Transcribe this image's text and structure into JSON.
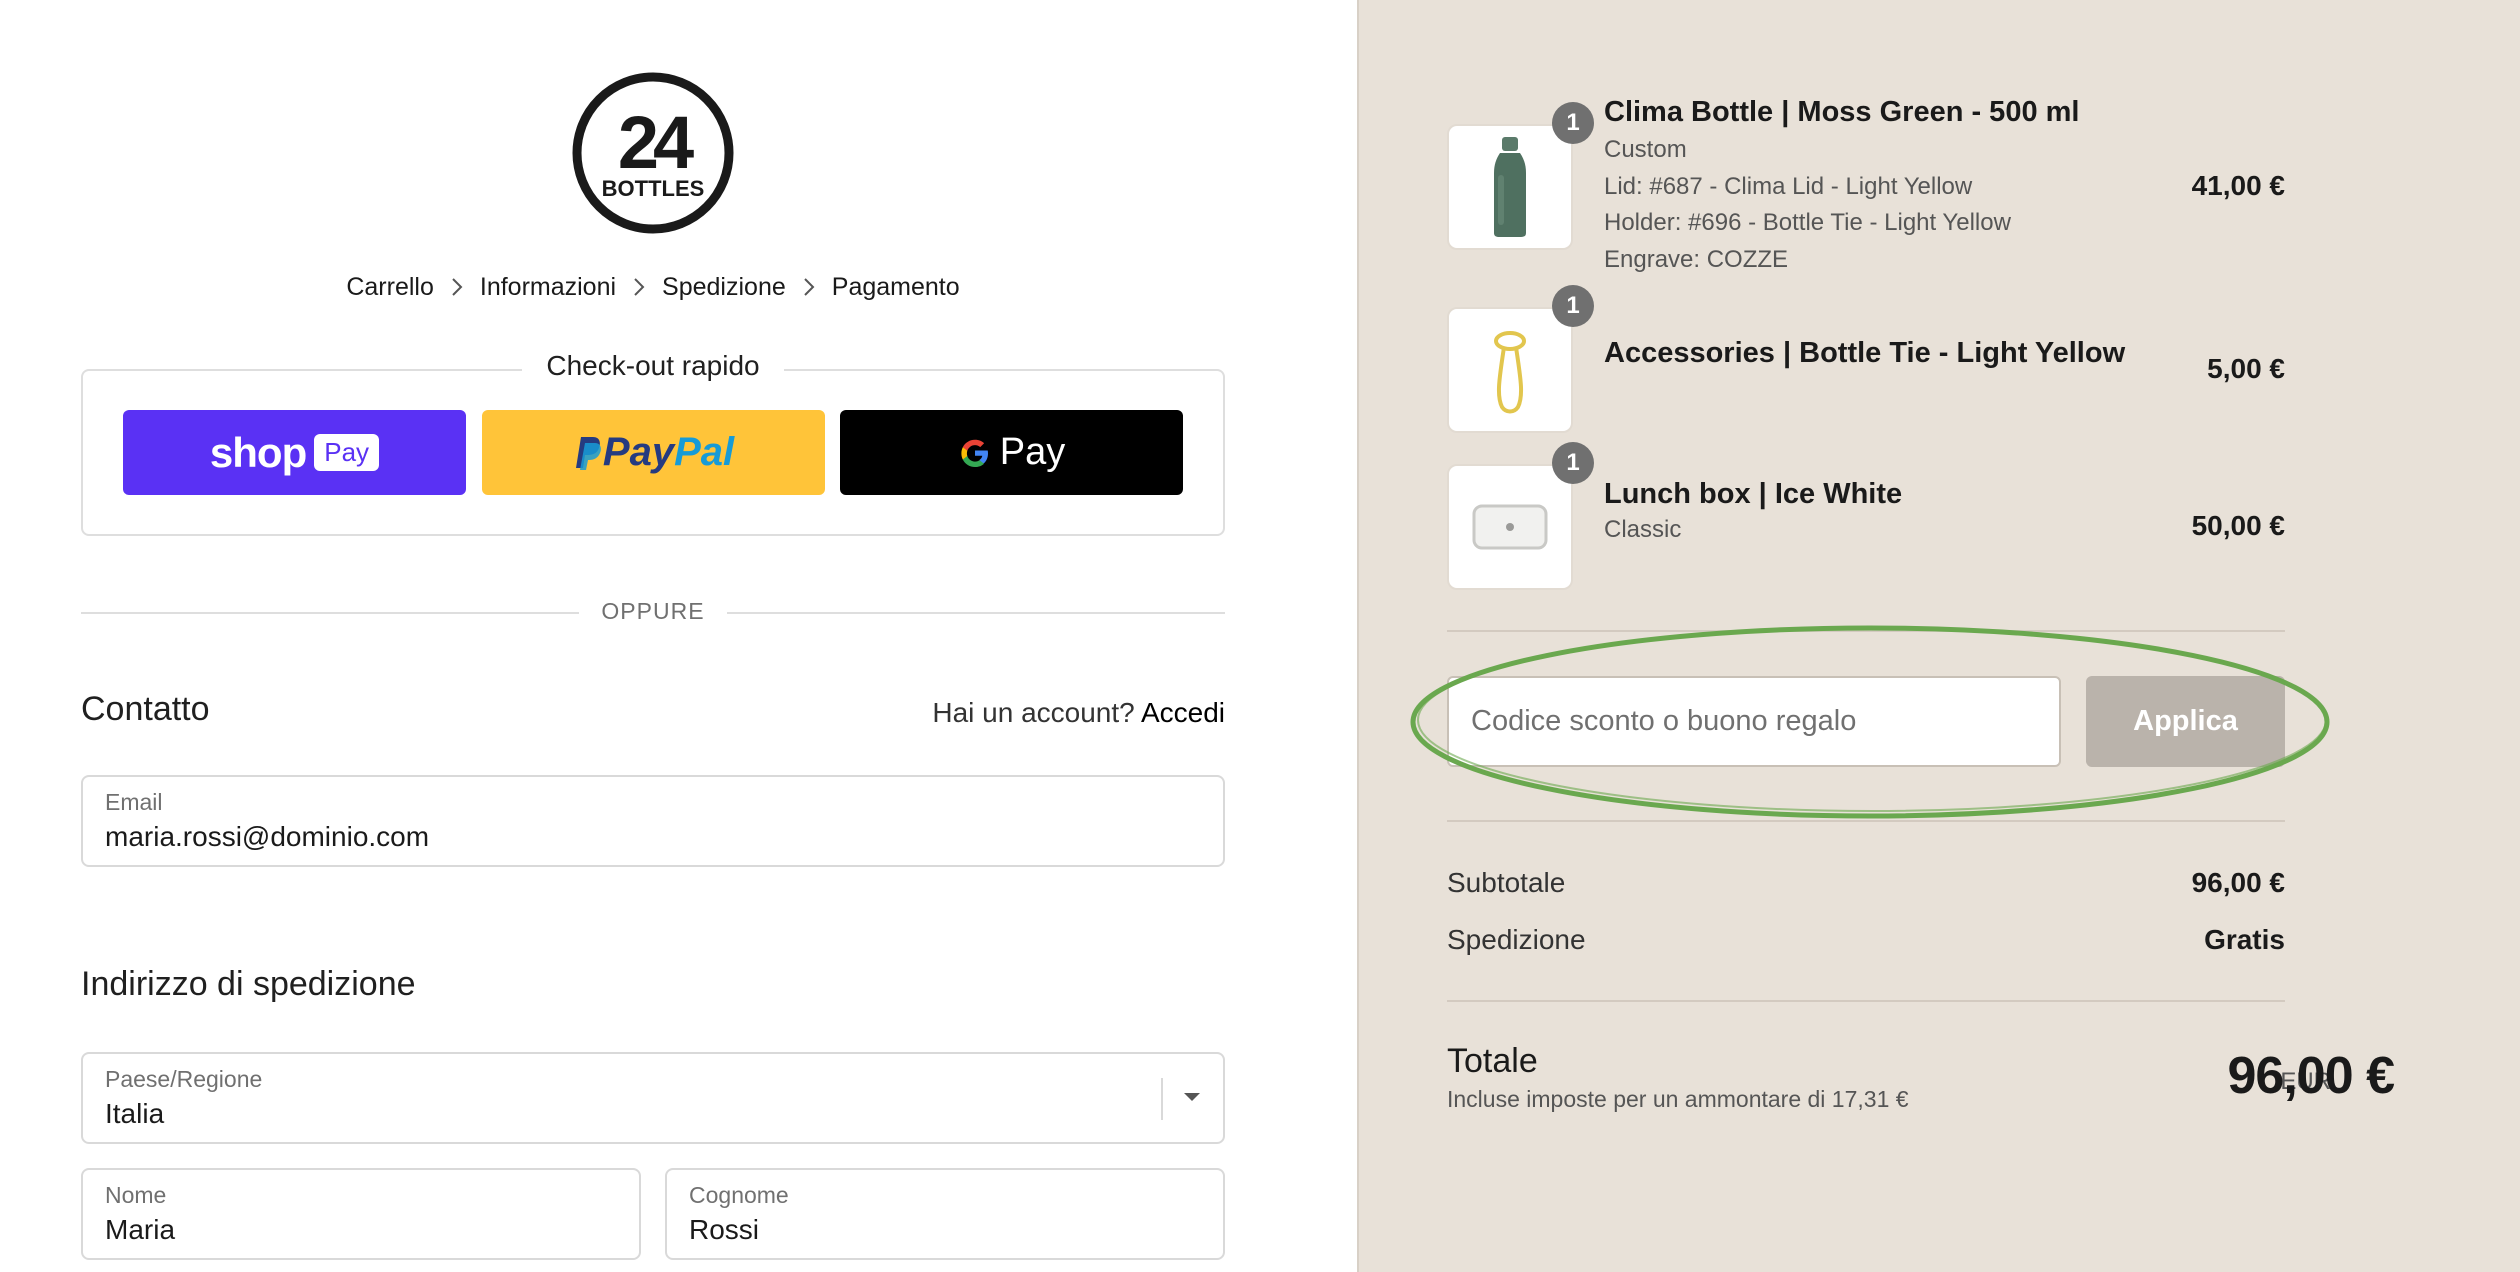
{
  "brand": {
    "logo_number": "24",
    "logo_word": "BOTTLES"
  },
  "breadcrumb": [
    "Carrello",
    "Informazioni",
    "Spedizione",
    "Pagamento"
  ],
  "express_checkout": {
    "title": "Check-out rapido",
    "shop_pay": {
      "word": "shop",
      "pill": "Pay"
    },
    "paypal": {
      "pay": "Pay",
      "pal": "Pal"
    },
    "gpay": {
      "word": "Pay"
    }
  },
  "divider_text": "OPPURE",
  "contact": {
    "title": "Contatto",
    "account_prompt": "Hai un account?",
    "login_link": "Accedi",
    "email_label": "Email",
    "email_value": "maria.rossi@dominio.com"
  },
  "shipping": {
    "title": "Indirizzo di spedizione",
    "country_label": "Paese/Regione",
    "country_value": "Italia",
    "first_name_label": "Nome",
    "first_name_value": "Maria",
    "last_name_label": "Cognome",
    "last_name_value": "Rossi"
  },
  "cart": {
    "items": [
      {
        "qty": "1",
        "name": "Clima Bottle | Moss Green - 500 ml",
        "details": [
          "Custom",
          "Lid: #687 - Clima Lid - Light Yellow",
          "Holder: #696 - Bottle Tie - Light Yellow",
          "Engrave: COZZE"
        ],
        "price": "41,00 €",
        "icon": "bottle-icon"
      },
      {
        "qty": "1",
        "name": "Accessories | Bottle Tie - Light Yellow",
        "details": [],
        "price": "5,00 €",
        "icon": "bottle-tie-icon"
      },
      {
        "qty": "1",
        "name": "Lunch box | Ice White",
        "details": [
          "Classic"
        ],
        "price": "50,00 €",
        "icon": "lunch-box-icon"
      }
    ],
    "discount_placeholder": "Codice sconto o buono regalo",
    "apply_label": "Applica",
    "subtotal_label": "Subtotale",
    "subtotal_value": "96,00 €",
    "shipping_label": "Spedizione",
    "shipping_value": "Gratis",
    "total_label": "Totale",
    "total_note": "Incluse imposte per un ammontare di 17,31 €",
    "total_currency": "EUR",
    "total_value": "96,00 €"
  },
  "colors": {
    "shop_pay": "#5a31f4",
    "paypal": "#ffc439",
    "gpay": "#000000",
    "summary_bg": "#e8e1d8",
    "highlight": "#6aa84f"
  }
}
